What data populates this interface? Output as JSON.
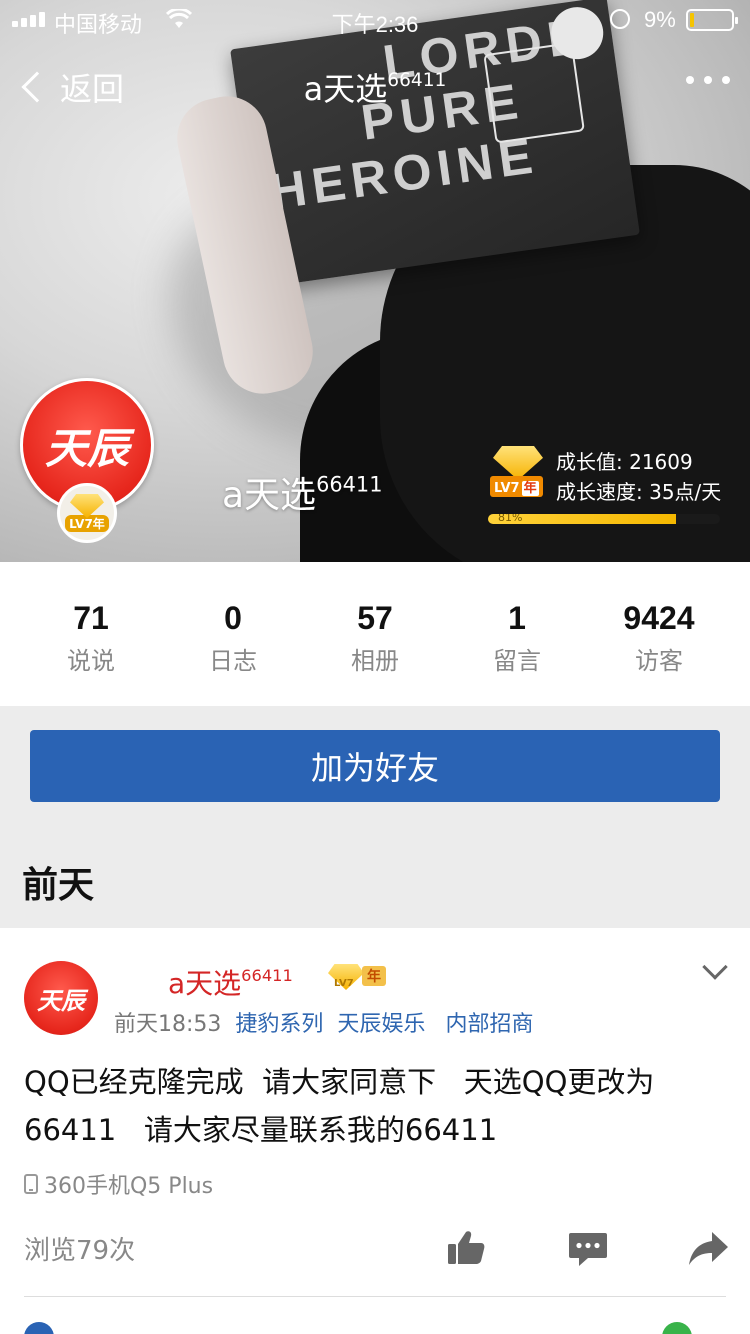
{
  "status_bar": {
    "carrier": "中国移动",
    "time": "下午2:36",
    "battery_percent": "9%",
    "battery_level": 0.09
  },
  "nav": {
    "back_label": "返回",
    "title": "a天选",
    "title_sup": "66411"
  },
  "cover": {
    "album_lines": [
      "LORDE",
      "PURE",
      "HEROINE"
    ],
    "display_name": "a天选",
    "display_name_sup": "66411",
    "avatar_text": "天辰",
    "level_badge": "LV7年",
    "growth_value": "成长值: 21609",
    "growth_speed": "成长速度: 35点/天",
    "vip_tag_lv": "LV7",
    "vip_tag_year": "年",
    "progress_label": "81%",
    "progress_fraction": 0.81
  },
  "stats": [
    {
      "value": "71",
      "label": "说说"
    },
    {
      "value": "0",
      "label": "日志"
    },
    {
      "value": "57",
      "label": "相册"
    },
    {
      "value": "1",
      "label": "留言"
    },
    {
      "value": "9424",
      "label": "访客"
    }
  ],
  "add_friend_label": "加为好友",
  "section_day": "前天",
  "post": {
    "avatar_text": "天辰",
    "name": "a天选",
    "name_sup": "66411",
    "vip_lv": "LV7",
    "vip_year": "年",
    "time": "前天18:53",
    "tags": [
      "捷豹系列",
      "天辰娱乐",
      "内部招商"
    ],
    "body_line1": "QQ已经克隆完成  请大家同意下   天选QQ更改为",
    "body_line2": "66411   请大家尽量联系我的66411",
    "device": "360手机Q5 Plus",
    "views": "浏览79次"
  },
  "colors": {
    "primary_blue": "#2a63b4",
    "name_red": "#d42626",
    "tag_blue": "#2f66b0",
    "gold": "#f5b800"
  },
  "icons": [
    "signal-icon",
    "wifi-icon",
    "lock-icon",
    "battery-icon",
    "back-chevron-icon",
    "more-icon",
    "gem-icon",
    "phone-icon",
    "like-icon",
    "comment-icon",
    "share-icon",
    "chevron-down-icon"
  ]
}
